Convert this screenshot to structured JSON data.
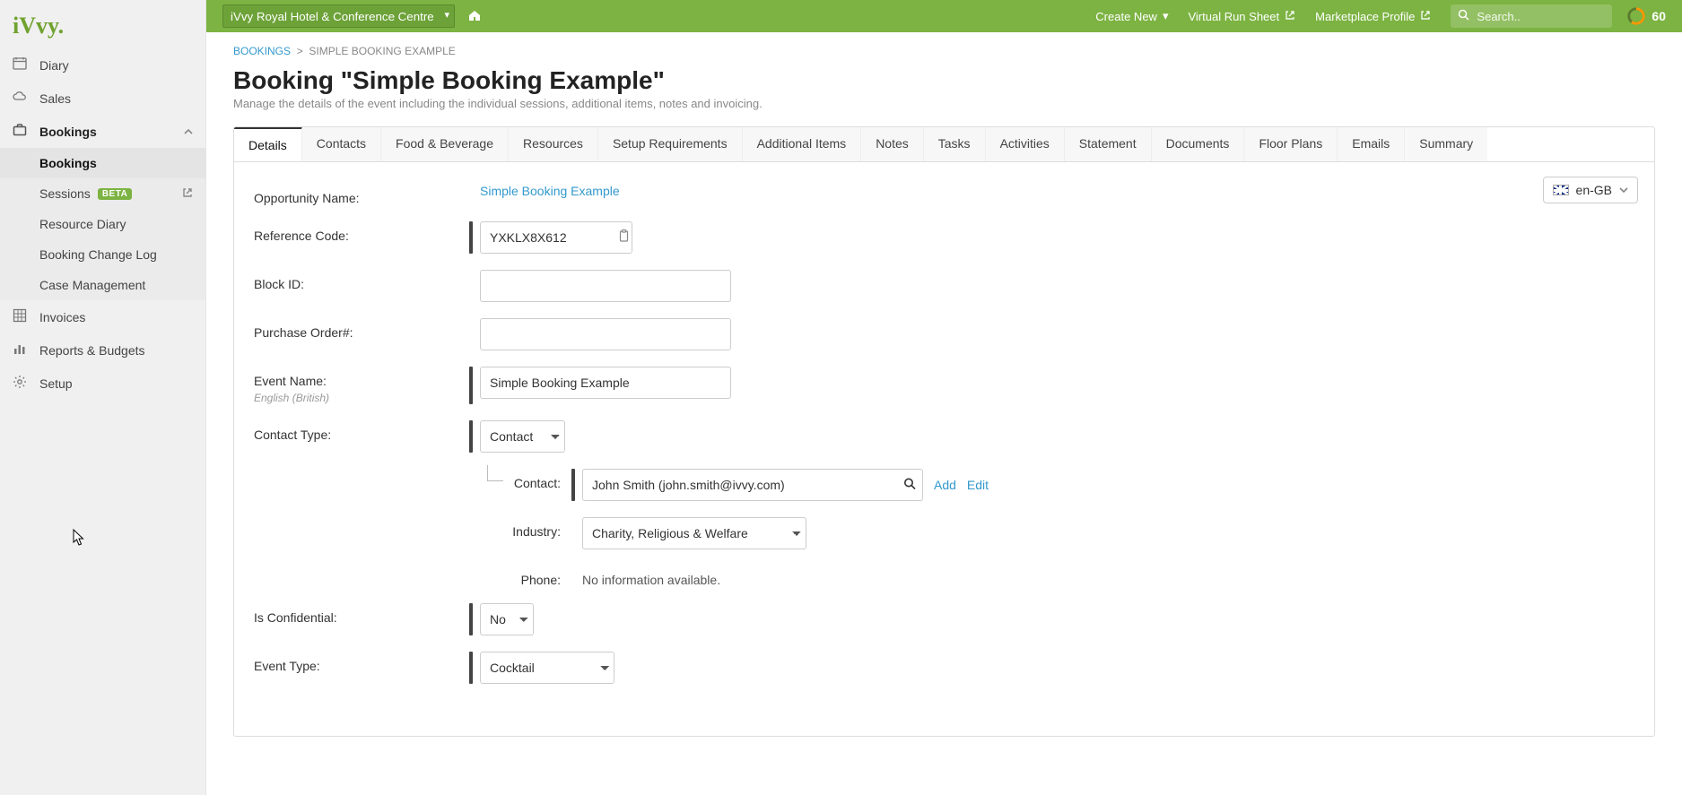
{
  "brand": "iVvy.",
  "topbar": {
    "venue": "iVvy Royal Hotel & Conference Centre",
    "create_new": "Create New",
    "virtual_run_sheet": "Virtual Run Sheet",
    "marketplace_profile": "Marketplace Profile",
    "search_placeholder": "Search..",
    "progress": "60"
  },
  "sidebar": {
    "items": [
      {
        "label": "Diary"
      },
      {
        "label": "Sales"
      },
      {
        "label": "Bookings",
        "expanded": true,
        "children": [
          {
            "label": "Bookings",
            "active": true
          },
          {
            "label": "Sessions",
            "beta": true,
            "external": true
          },
          {
            "label": "Resource Diary"
          },
          {
            "label": "Booking Change Log"
          },
          {
            "label": "Case Management"
          }
        ]
      },
      {
        "label": "Invoices"
      },
      {
        "label": "Reports & Budgets"
      },
      {
        "label": "Setup"
      }
    ]
  },
  "breadcrumb": {
    "root": "BOOKINGS",
    "sep": ">",
    "leaf": "SIMPLE BOOKING EXAMPLE"
  },
  "page_title": "Booking \"Simple Booking Example\"",
  "page_subtitle": "Manage the details of the event including the individual sessions, additional items, notes and invoicing.",
  "tabs": [
    "Details",
    "Contacts",
    "Food & Beverage",
    "Resources",
    "Setup Requirements",
    "Additional Items",
    "Notes",
    "Tasks",
    "Activities",
    "Statement",
    "Documents",
    "Floor Plans",
    "Emails",
    "Summary"
  ],
  "active_tab": 0,
  "locale": {
    "label": "en-GB"
  },
  "form": {
    "opportunity_name_label": "Opportunity Name:",
    "opportunity_name_link": "Simple Booking Example",
    "reference_code_label": "Reference Code:",
    "reference_code_value": "YXKLX8X612",
    "block_id_label": "Block ID:",
    "block_id_value": "",
    "purchase_order_label": "Purchase Order#:",
    "purchase_order_value": "",
    "event_name_label": "Event Name:",
    "event_name_hint": "English (British)",
    "event_name_value": "Simple Booking Example",
    "contact_type_label": "Contact Type:",
    "contact_type_value": "Contact",
    "contact_label": "Contact:",
    "contact_value": "John Smith (john.smith@ivvy.com)",
    "add_label": "Add",
    "edit_label": "Edit",
    "industry_label": "Industry:",
    "industry_value": "Charity, Religious & Welfare",
    "phone_label": "Phone:",
    "phone_value": "No information available.",
    "is_confidential_label": "Is Confidential:",
    "is_confidential_value": "No",
    "event_type_label": "Event Type:",
    "event_type_value": "Cocktail"
  },
  "sidebar_beta_badge": "BETA"
}
